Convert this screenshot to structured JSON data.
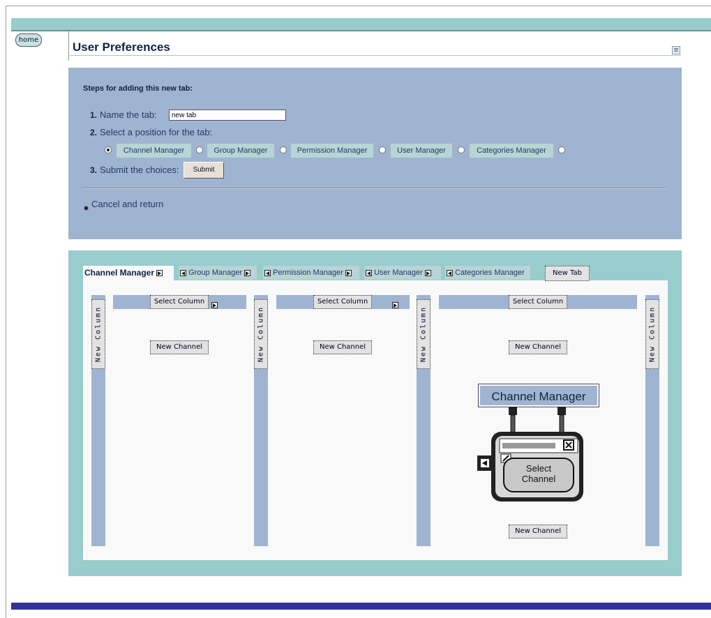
{
  "header": {
    "home_label": "home",
    "page_title": "User Preferences"
  },
  "steps": {
    "heading": "Steps for adding this new tab:",
    "step1_number": "1.",
    "step1_label": "Name the tab:",
    "tab_name_value": "new tab",
    "step2_number": "2.",
    "step2_label": "Select a position for the tab:",
    "positions": [
      "Channel Manager",
      "Group Manager",
      "Permission Manager",
      "User Manager",
      "Categories Manager"
    ],
    "selected_position_index": 0,
    "step3_number": "3.",
    "step3_label": "Submit the choices:",
    "submit_label": "Submit",
    "cancel_label": "Cancel and return"
  },
  "layout": {
    "tabs": [
      "Channel Manager",
      "Group Manager",
      "Permission Manager",
      "User Manager",
      "Categories Manager"
    ],
    "active_tab_index": 0,
    "new_tab_label": "New Tab",
    "new_column_label": "New Column",
    "select_column_label": "Select Column",
    "new_channel_label": "New Channel",
    "channel_card_title": "Channel Manager",
    "select_channel_label": "Select Channel"
  },
  "colors": {
    "teal": "#99cccc",
    "slate_blue": "#9fb4d1",
    "navy_text": "#112244",
    "bottom_bar": "#33339a"
  }
}
